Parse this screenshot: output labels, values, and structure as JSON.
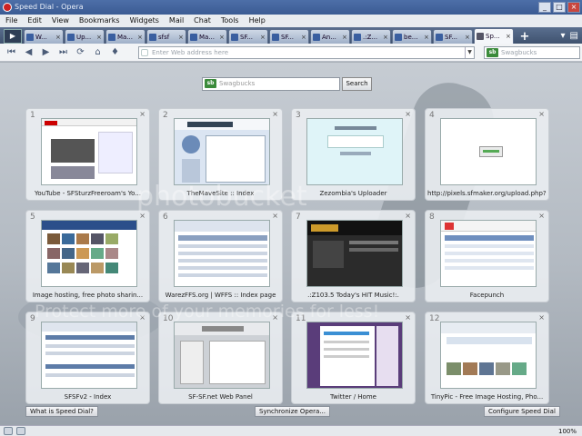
{
  "window": {
    "title": "Speed Dial - Opera"
  },
  "menu": [
    "File",
    "Edit",
    "View",
    "Bookmarks",
    "Widgets",
    "Mail",
    "Chat",
    "Tools",
    "Help"
  ],
  "tabs": [
    {
      "label": "W..."
    },
    {
      "label": "Up..."
    },
    {
      "label": "Ma..."
    },
    {
      "label": "sfsf"
    },
    {
      "label": "Ma..."
    },
    {
      "label": "SF..."
    },
    {
      "label": "SF..."
    },
    {
      "label": "An..."
    },
    {
      "label": ".:Z..."
    },
    {
      "label": "be..."
    },
    {
      "label": "SF..."
    },
    {
      "label": "Sp...",
      "active": true
    }
  ],
  "address": {
    "placeholder": "Enter Web address here"
  },
  "nav_search": {
    "placeholder": "Swagbucks"
  },
  "speed_dial_search": {
    "placeholder": "Swagbucks",
    "button": "Search"
  },
  "dials": [
    {
      "num": "1",
      "caption": "YouTube - SFSturzFreeroam's Yo...",
      "theme": "#e9eef5"
    },
    {
      "num": "2",
      "caption": "TheMaveSite :: Index",
      "theme": "#d7e2f0"
    },
    {
      "num": "3",
      "caption": "Zezombia's Uploader",
      "theme": "#dff3f7"
    },
    {
      "num": "4",
      "caption": "http://pixels.sfmaker.org/upload.php?pi...",
      "theme": "#fafafa"
    },
    {
      "num": "5",
      "caption": "Image hosting, free photo sharin...",
      "theme": "#eef2f6"
    },
    {
      "num": "6",
      "caption": "WarezFFS.org | WFFS :: Index page",
      "theme": "#e8edf3"
    },
    {
      "num": "7",
      "caption": ".:Z103.5 Today's HIT Music!:.",
      "theme": "#2a2a2a"
    },
    {
      "num": "8",
      "caption": "Facepunch",
      "theme": "#e9eef6"
    },
    {
      "num": "9",
      "caption": "SFSFv2 - Index",
      "theme": "#e6ebf1"
    },
    {
      "num": "10",
      "caption": "SF-SF.net Web Panel",
      "theme": "#cdd1d6"
    },
    {
      "num": "11",
      "caption": "Twitter / Home",
      "theme": "#5a3d7a"
    },
    {
      "num": "12",
      "caption": "TinyPic - Free Image Hosting, Pho...",
      "theme": "#eef2f6"
    }
  ],
  "bottom": {
    "what": "What is Speed Dial?",
    "sync": "Synchronize Opera...",
    "configure": "Configure Speed Dial"
  },
  "watermark": {
    "line1": "photobucket",
    "line2": "Protect more of your memories for less!"
  },
  "status": {
    "zoom": "100%"
  }
}
